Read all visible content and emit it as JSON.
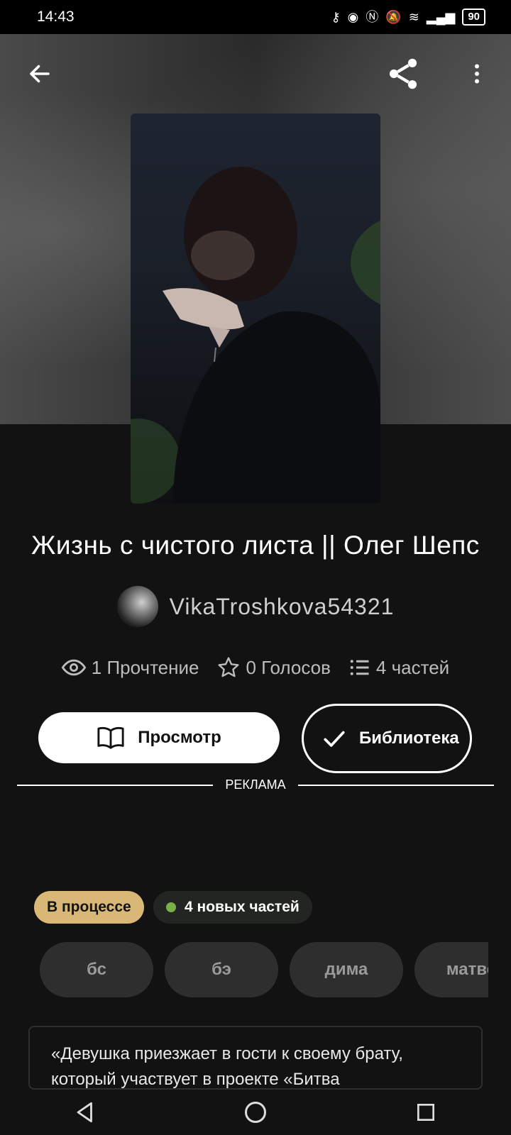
{
  "status_bar": {
    "time": "14:43",
    "battery": "90",
    "icons": [
      "whatsapp-icon",
      "key-icon",
      "eye-icon",
      "nfc-icon",
      "mute-icon",
      "wifi-icon",
      "signal-icon",
      "battery-icon"
    ]
  },
  "toolbar": {
    "back_icon": "back-arrow-icon",
    "share_icon": "share-icon",
    "more_icon": "more-vertical-icon"
  },
  "story": {
    "title": "Жизнь с чистого листа || Олег Шепс",
    "author": "VikaTroshkova54321",
    "stats": {
      "reads": "1 Прочтение",
      "votes": "0 Голосов",
      "parts": "4 частей"
    },
    "status_badge": "В процессе",
    "new_parts_badge": "4 новых частей",
    "tags": [
      "бс",
      "бэ",
      "дима",
      "матве"
    ],
    "description": "«Девушка приезжает в гости к своему брату, который участвует в проекте «Битва"
  },
  "actions": {
    "view_label": "Просмотр",
    "library_label": "Библиотека"
  },
  "ad": {
    "label": "РЕКЛАМА"
  },
  "colors": {
    "background": "#121212",
    "status_badge_bg": "#d9b877",
    "new_parts_dot": "#7ab04a",
    "tag_bg": "#2e2e2e"
  }
}
